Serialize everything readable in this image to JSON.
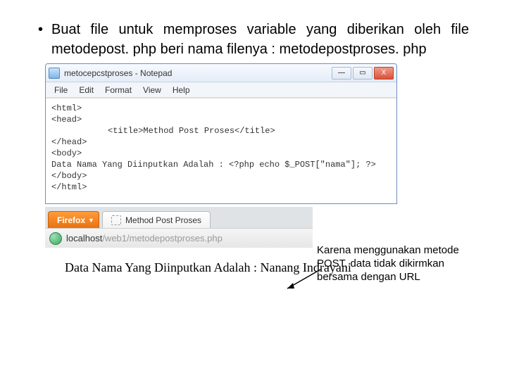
{
  "bullet": "•",
  "instruction": "Buat file untuk memproses variable yang diberikan oleh file metodepost. php beri  nama filenya : metodepostproses. php",
  "notepad": {
    "title": "metocepcstproses - Notepad",
    "menu": {
      "file": "File",
      "edit": "Edit",
      "format": "Format",
      "view": "View",
      "help": "Help"
    },
    "code": {
      "l1": "<html>",
      "l2": "<head>",
      "l3": "<title>Method Post Proses</title>",
      "l4": "</head>",
      "l5": "<body>",
      "l6": "Data Nama Yang Diinputkan Adalah : <?php echo $_POST[\"nama\"]; ?>",
      "l7": "</body>",
      "l8": "</html>"
    },
    "win": {
      "min": "—",
      "max": "▭",
      "close": "X"
    }
  },
  "firefox": {
    "menu_label": "Firefox",
    "tab_label": "Method Post Proses",
    "url_dark": "localhost",
    "url_grey": "/web1/metodepostproses.php"
  },
  "annotation": "Karena menggunakan metode POST, data tidak dikirmkan bersama dengan URL",
  "output": "Data Nama Yang Diinputkan Adalah : Nanang Indrayani"
}
